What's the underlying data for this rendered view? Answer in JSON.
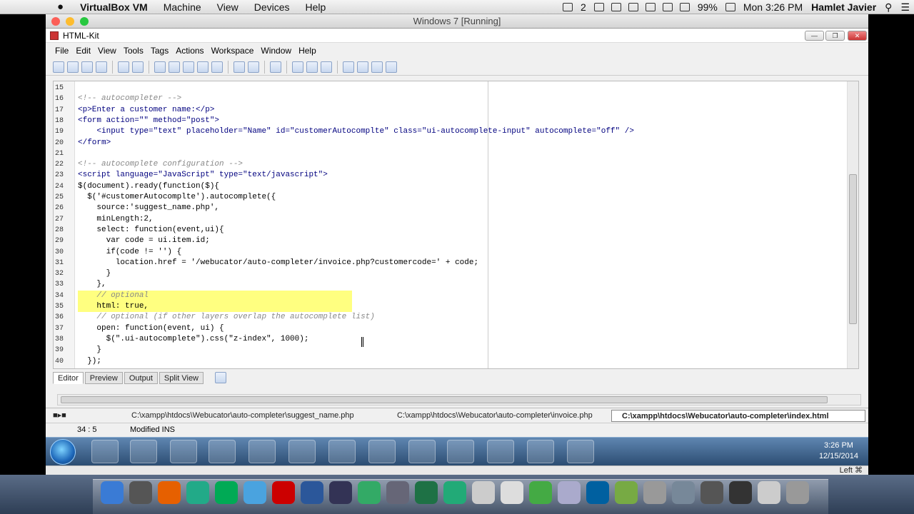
{
  "mac_menubar": {
    "app_name": "VirtualBox VM",
    "menus": [
      "Machine",
      "View",
      "Devices",
      "Help"
    ],
    "status_items": [
      "2",
      "99%",
      "Mon 3:26 PM",
      "Hamlet Javier"
    ]
  },
  "vbox_window": {
    "title": "Windows 7 [Running]",
    "status_right": "Left ⌘"
  },
  "app": {
    "title": "HTML-Kit",
    "menus": [
      "File",
      "Edit",
      "View",
      "Tools",
      "Tags",
      "Actions",
      "Workspace",
      "Window",
      "Help"
    ]
  },
  "editor": {
    "lines": [
      {
        "n": "15",
        "t": ""
      },
      {
        "n": "16",
        "t": "<!-- autocompleter -->"
      },
      {
        "n": "17",
        "t": "<p>Enter a customer name:</p>"
      },
      {
        "n": "18",
        "t": "<form action=\"\" method=\"post\">"
      },
      {
        "n": "19",
        "t": "    <input type=\"text\" placeholder=\"Name\" id=\"customerAutocomplte\" class=\"ui-autocomplete-input\" autocomplete=\"off\" />"
      },
      {
        "n": "20",
        "t": "</form>"
      },
      {
        "n": "21",
        "t": ""
      },
      {
        "n": "22",
        "t": "<!-- autocomplete configuration -->"
      },
      {
        "n": "23",
        "t": "<script language=\"JavaScript\" type=\"text/javascript\">"
      },
      {
        "n": "24",
        "t": "$(document).ready(function($){"
      },
      {
        "n": "25",
        "t": "  $('#customerAutocomplte').autocomplete({"
      },
      {
        "n": "26",
        "t": "    source:'suggest_name.php',"
      },
      {
        "n": "27",
        "t": "    minLength:2,"
      },
      {
        "n": "28",
        "t": "    select: function(event,ui){"
      },
      {
        "n": "29",
        "t": "      var code = ui.item.id;"
      },
      {
        "n": "30",
        "t": "      if(code != '') {"
      },
      {
        "n": "31",
        "t": "        location.href = '/webucator/auto-completer/invoice.php?customercode=' + code;"
      },
      {
        "n": "32",
        "t": "      }"
      },
      {
        "n": "33",
        "t": "    },"
      },
      {
        "n": "34",
        "t": "    // optional"
      },
      {
        "n": "35",
        "t": "    html: true,"
      },
      {
        "n": "36",
        "t": "    // optional (if other layers overlap the autocomplete list)"
      },
      {
        "n": "37",
        "t": "    open: function(event, ui) {"
      },
      {
        "n": "38",
        "t": "      $(\".ui-autocomplete\").css(\"z-index\", 1000);"
      },
      {
        "n": "39",
        "t": "    }"
      },
      {
        "n": "40",
        "t": "  });"
      }
    ],
    "highlighted_lines": [
      "34",
      "35"
    ]
  },
  "editor_tabs": [
    "Editor",
    "Preview",
    "Output",
    "Split View"
  ],
  "file_tabs": [
    {
      "label": "C:\\xampp\\htdocs\\Webucator\\auto-completer\\suggest_name.php"
    },
    {
      "label": "C:\\xampp\\htdocs\\Webucator\\auto-completer\\invoice.php"
    },
    {
      "label": "C:\\xampp\\htdocs\\Webucator\\auto-completer\\index.html"
    }
  ],
  "statusbar": {
    "position": "34 : 5",
    "mode": "Modified INS"
  },
  "taskbar": {
    "clock_time": "3:26 PM",
    "clock_date": "12/15/2014",
    "apps": [
      "ie",
      "chrome",
      "firefox",
      "explorer",
      "tools",
      "xampp",
      "app",
      "app",
      "html-kit",
      "kdiff3",
      "app",
      "app",
      "tester"
    ]
  },
  "dock": {
    "apps": [
      "finder",
      "launchpad",
      "firefox",
      "chrome",
      "Dw",
      "safari",
      "acrobat",
      "word",
      "Cf",
      "app",
      "db",
      "excel",
      "app",
      "app",
      "app",
      "app",
      "app",
      "Ps",
      "app",
      "app",
      "app",
      "app",
      "app",
      "app",
      "trash"
    ]
  }
}
